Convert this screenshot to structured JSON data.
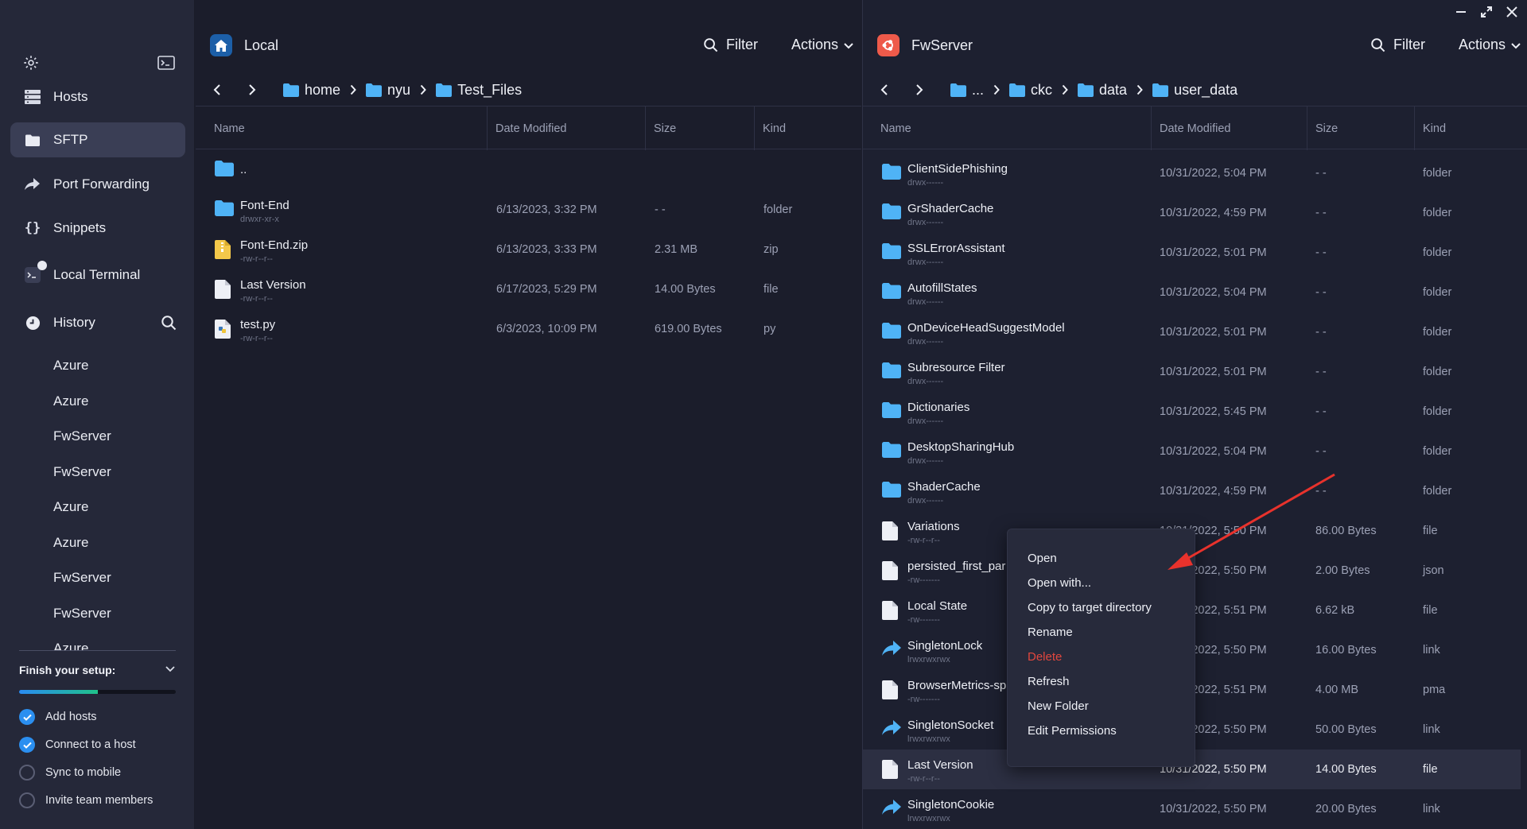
{
  "sidebar": {
    "nav": {
      "hosts": "Hosts",
      "sftp": "SFTP",
      "port_forwarding": "Port Forwarding",
      "snippets": "Snippets",
      "local_terminal": "Local Terminal",
      "history": "History"
    },
    "history_items": [
      "Azure",
      "Azure",
      "FwServer",
      "FwServer",
      "Azure",
      "Azure",
      "FwServer",
      "FwServer",
      "Azure"
    ],
    "setup": {
      "title": "Finish your setup:",
      "progress": 0.5,
      "items": [
        {
          "label": "Add hosts",
          "done": true
        },
        {
          "label": "Connect to a host",
          "done": true
        },
        {
          "label": "Sync to mobile",
          "done": false
        },
        {
          "label": "Invite team members",
          "done": false
        }
      ]
    }
  },
  "local": {
    "title": "Local",
    "filter": "Filter",
    "actions": "Actions",
    "crumbs": [
      "home",
      "nyu",
      "Test_Files"
    ],
    "columns": {
      "name": "Name",
      "date": "Date Modified",
      "size": "Size",
      "kind": "Kind"
    },
    "rows": [
      {
        "name": "..",
        "perm": "",
        "date": "",
        "size": "",
        "kind": ""
      },
      {
        "name": "Font-End",
        "perm": "drwxr-xr-x",
        "date": "6/13/2023, 3:32 PM",
        "size": "- -",
        "kind": "folder"
      },
      {
        "name": "Font-End.zip",
        "perm": "-rw-r--r--",
        "date": "6/13/2023, 3:33 PM",
        "size": "2.31 MB",
        "kind": "zip"
      },
      {
        "name": "Last Version",
        "perm": "-rw-r--r--",
        "date": "6/17/2023, 5:29 PM",
        "size": "14.00 Bytes",
        "kind": "file"
      },
      {
        "name": "test.py",
        "perm": "-rw-r--r--",
        "date": "6/3/2023, 10:09 PM",
        "size": "619.00 Bytes",
        "kind": "py"
      }
    ]
  },
  "remote": {
    "title": "FwServer",
    "filter": "Filter",
    "actions": "Actions",
    "crumbs": [
      "...",
      "ckc",
      "data",
      "user_data"
    ],
    "columns": {
      "name": "Name",
      "date": "Date Modified",
      "size": "Size",
      "kind": "Kind"
    },
    "rows": [
      {
        "name": "ClientSidePhishing",
        "perm": "drwx------",
        "date": "10/31/2022, 5:04 PM",
        "size": "- -",
        "kind": "folder"
      },
      {
        "name": "GrShaderCache",
        "perm": "drwx------",
        "date": "10/31/2022, 4:59 PM",
        "size": "- -",
        "kind": "folder"
      },
      {
        "name": "SSLErrorAssistant",
        "perm": "drwx------",
        "date": "10/31/2022, 5:01 PM",
        "size": "- -",
        "kind": "folder"
      },
      {
        "name": "AutofillStates",
        "perm": "drwx------",
        "date": "10/31/2022, 5:04 PM",
        "size": "- -",
        "kind": "folder"
      },
      {
        "name": "OnDeviceHeadSuggestModel",
        "perm": "drwx------",
        "date": "10/31/2022, 5:01 PM",
        "size": "- -",
        "kind": "folder"
      },
      {
        "name": "Subresource Filter",
        "perm": "drwx------",
        "date": "10/31/2022, 5:01 PM",
        "size": "- -",
        "kind": "folder"
      },
      {
        "name": "Dictionaries",
        "perm": "drwx------",
        "date": "10/31/2022, 5:45 PM",
        "size": "- -",
        "kind": "folder"
      },
      {
        "name": "DesktopSharingHub",
        "perm": "drwx------",
        "date": "10/31/2022, 5:04 PM",
        "size": "- -",
        "kind": "folder"
      },
      {
        "name": "ShaderCache",
        "perm": "drwx------",
        "date": "10/31/2022, 4:59 PM",
        "size": "- -",
        "kind": "folder"
      },
      {
        "name": "Variations",
        "perm": "-rw-r--r--",
        "date": "10/31/2022, 5:50 PM",
        "size": "86.00 Bytes",
        "kind": "file"
      },
      {
        "name": "persisted_first_par",
        "perm": "-rw-------",
        "date": "10/31/2022, 5:50 PM",
        "size": "2.00 Bytes",
        "kind": "json"
      },
      {
        "name": "Local State",
        "perm": "-rw-------",
        "date": "10/31/2022, 5:51 PM",
        "size": "6.62 kB",
        "kind": "file"
      },
      {
        "name": "SingletonLock",
        "perm": "lrwxrwxrwx",
        "date": "10/31/2022, 5:50 PM",
        "size": "16.00 Bytes",
        "kind": "link"
      },
      {
        "name": "BrowserMetrics-sp",
        "perm": "-rw-------",
        "date": "10/31/2022, 5:51 PM",
        "size": "4.00 MB",
        "kind": "pma"
      },
      {
        "name": "SingletonSocket",
        "perm": "lrwxrwxrwx",
        "date": "10/31/2022, 5:50 PM",
        "size": "50.00 Bytes",
        "kind": "link"
      },
      {
        "name": "Last Version",
        "perm": "-rw-r--r--",
        "date": "10/31/2022, 5:50 PM",
        "size": "14.00 Bytes",
        "kind": "file"
      },
      {
        "name": "SingletonCookie",
        "perm": "lrwxrwxrwx",
        "date": "10/31/2022, 5:50 PM",
        "size": "20.00 Bytes",
        "kind": "link"
      }
    ]
  },
  "context_menu": {
    "items": [
      "Open",
      "Open with...",
      "Copy to target directory",
      "Rename",
      "Delete",
      "Refresh",
      "New Folder",
      "Edit Permissions"
    ]
  },
  "colors": {
    "accent": "#2b8ff0",
    "folder": "#4fb3f6",
    "danger": "#e2473e",
    "arrow": "#e8322c"
  }
}
